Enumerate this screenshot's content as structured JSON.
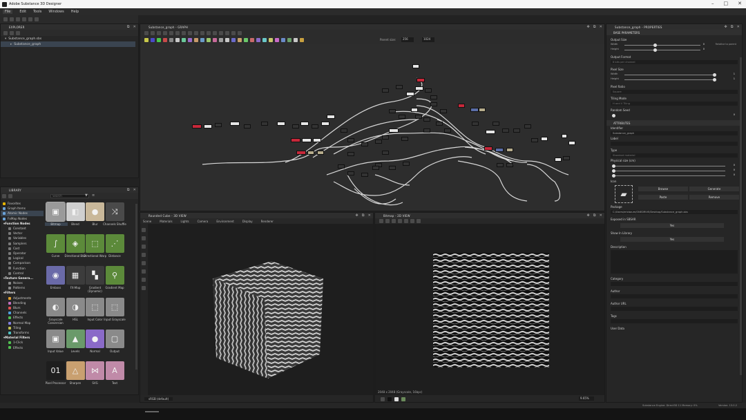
{
  "window": {
    "title": "Adobe Substance 3D Designer"
  },
  "menu": [
    "File",
    "Edit",
    "Tools",
    "Windows",
    "Help"
  ],
  "explorer": {
    "header": "EXPLORER",
    "file": "Substance_graph.sbs",
    "graph": "Substance_graph"
  },
  "graph": {
    "header": "Substance_graph - GRAPH",
    "parent_size_label": "Parent size:",
    "parent_size_value": "256",
    "size_value": "1024"
  },
  "library": {
    "header": "LIBRARY",
    "search_placeholder": "Search",
    "categories": [
      {
        "name": "Favorites",
        "type": "cat-item",
        "color": "#e6b400"
      },
      {
        "name": "Graph Items",
        "type": "cat-item",
        "color": "#6aa2d8"
      },
      {
        "name": "Atomic Nodes",
        "type": "cat-item-sel",
        "color": "#6aa2d8"
      },
      {
        "name": "FxMap Nodes",
        "type": "cat-item",
        "color": "#6aa2d8"
      },
      {
        "name": "Function Nodes",
        "type": "cat",
        "color": "#9a9a9a"
      },
      {
        "name": "Constant",
        "type": "sub",
        "color": "#7a7a7a"
      },
      {
        "name": "Vector",
        "type": "sub",
        "color": "#7a7a7a"
      },
      {
        "name": "Variables",
        "type": "sub",
        "color": "#7a7a7a"
      },
      {
        "name": "Samplers",
        "type": "sub",
        "color": "#7a7a7a"
      },
      {
        "name": "Cast",
        "type": "sub",
        "color": "#7a7a7a"
      },
      {
        "name": "Operator",
        "type": "sub",
        "color": "#7a7a7a"
      },
      {
        "name": "Logical",
        "type": "sub",
        "color": "#7a7a7a"
      },
      {
        "name": "Comparison",
        "type": "sub",
        "color": "#7a7a7a"
      },
      {
        "name": "Function",
        "type": "sub",
        "color": "#7a7a7a"
      },
      {
        "name": "Control",
        "type": "sub",
        "color": "#7a7a7a"
      },
      {
        "name": "Texture Genera...",
        "type": "cat",
        "color": "#9a9a9a"
      },
      {
        "name": "Noises",
        "type": "sub",
        "color": "#8a8a8a"
      },
      {
        "name": "Patterns",
        "type": "sub",
        "color": "#8a8a8a"
      },
      {
        "name": "Filters",
        "type": "cat",
        "color": "#9a9a9a"
      },
      {
        "name": "Adjustments",
        "type": "sub",
        "color": "#e0a030"
      },
      {
        "name": "Blending",
        "type": "sub",
        "color": "#c070c0"
      },
      {
        "name": "Blurs",
        "type": "sub",
        "color": "#e05050"
      },
      {
        "name": "Channels",
        "type": "sub",
        "color": "#50a0e0"
      },
      {
        "name": "Effects",
        "type": "sub",
        "color": "#50c050"
      },
      {
        "name": "Normal Map",
        "type": "sub",
        "color": "#8080e0"
      },
      {
        "name": "Tiling",
        "type": "sub",
        "color": "#c0c050"
      },
      {
        "name": "Transforms",
        "type": "sub",
        "color": "#50c0c0"
      },
      {
        "name": "Material Filters",
        "type": "cat",
        "color": "#9a9a9a"
      },
      {
        "name": "1-Click",
        "type": "sub",
        "color": "#50c050"
      },
      {
        "name": "Effects",
        "type": "sub",
        "color": "#50c050"
      }
    ],
    "tiles": [
      {
        "label": "Bitmap",
        "color": "#9a9a9a",
        "glyph": "▣"
      },
      {
        "label": "Blend",
        "color": "#cfcfcf",
        "glyph": "◧"
      },
      {
        "label": "Blur",
        "color": "#c9b89a",
        "glyph": "●"
      },
      {
        "label": "Channels Shuffle",
        "color": "#4a4a4a",
        "glyph": "⤨"
      },
      {
        "label": "Curve",
        "color": "#5c8a3a",
        "glyph": "∫"
      },
      {
        "label": "Directional Blur",
        "color": "#5c8a3a",
        "glyph": "◈"
      },
      {
        "label": "Directional Warp",
        "color": "#5c8a3a",
        "glyph": "⬚"
      },
      {
        "label": "Distance",
        "color": "#5c8a3a",
        "glyph": "⋰"
      },
      {
        "label": "Emboss",
        "color": "#6a6aa8",
        "glyph": "◉"
      },
      {
        "label": "FX-Map",
        "color": "#3c3c3c",
        "glyph": "▦"
      },
      {
        "label": "Gradient (Dynamic)",
        "color": "#3c3c3c",
        "glyph": "▚"
      },
      {
        "label": "Gradient Map",
        "color": "#5c8a3a",
        "glyph": "⚲"
      },
      {
        "label": "Grayscale Conversion",
        "color": "#8a8a8a",
        "glyph": "◐"
      },
      {
        "label": "HSL",
        "color": "#8a8a8a",
        "glyph": "◑"
      },
      {
        "label": "Input Color",
        "color": "#8a8a8a",
        "glyph": "⬚"
      },
      {
        "label": "Input Grayscale",
        "color": "#8a8a8a",
        "glyph": "⬚"
      },
      {
        "label": "Input Value",
        "color": "#8a8a8a",
        "glyph": "▣"
      },
      {
        "label": "Levels",
        "color": "#6a9a6a",
        "glyph": "▲"
      },
      {
        "label": "Normal",
        "color": "#8a6ac8",
        "glyph": "●"
      },
      {
        "label": "Output",
        "color": "#8a8a8a",
        "glyph": "▢"
      },
      {
        "label": "Pixel Processor",
        "color": "#1e1e1e",
        "glyph": "01"
      },
      {
        "label": "Sharpen",
        "color": "#c9a070",
        "glyph": "△"
      },
      {
        "label": "SVG",
        "color": "#c08aa8",
        "glyph": "⋈"
      },
      {
        "label": "Text",
        "color": "#c08aa8",
        "glyph": "A"
      }
    ]
  },
  "view3d": {
    "header": "Rounded Cube - 3D VIEW",
    "tabs": [
      "Scene",
      "Materials",
      "Lights",
      "Camera",
      "Environment",
      "Display",
      "Renderer"
    ],
    "status": "sRGB (default)"
  },
  "view2d": {
    "header": "Bitmap - 2D VIEW",
    "status": "2048 x 2048 (Grayscale, 16bpc)",
    "zoom": "9.65%"
  },
  "properties": {
    "header": "Substance_graph - PROPERTIES",
    "sections": {
      "base": "BASE PARAMETERS",
      "attributes": "ATTRIBUTES"
    },
    "output_size": {
      "label": "Output Size",
      "width_label": "Width",
      "height_label": "Height",
      "width_val": "0",
      "height_val": "0",
      "rel": "Relative to parent"
    },
    "output_format": {
      "label": "Output Format",
      "value": "8 bits per channel"
    },
    "pixel_size": {
      "label": "Pixel Size",
      "width_label": "Width",
      "height_label": "Height",
      "width_val": "1",
      "height_val": "1"
    },
    "pixel_ratio": {
      "label": "Pixel Ratio",
      "value": "Square"
    },
    "tiling_mode": {
      "label": "Tiling Mode",
      "value": "H and V Tiling"
    },
    "random_seed": {
      "label": "Random Seed",
      "value": "0"
    },
    "identifier": {
      "label": "Identifier",
      "value": "Substance_graph"
    },
    "label": {
      "label": "Label"
    },
    "type": {
      "label": "Type",
      "value": "Standard material"
    },
    "physical": {
      "label": "Physical size (cm)",
      "x": "0",
      "y": "0",
      "z": "0"
    },
    "icon": {
      "label": "Icon",
      "browse": "Browse",
      "generate": "Generate",
      "paste": "Paste",
      "remove": "Remove"
    },
    "package": {
      "label": "Package",
      "value": "C:/Users/ericbaum/ONEDRIVE/Desktop/Substance_graph.sbs"
    },
    "exposed": {
      "label": "Exposed in SBSAR",
      "value": "Yes"
    },
    "show_library": {
      "label": "Show In Library",
      "value": "Yes"
    },
    "description": {
      "label": "Description"
    },
    "category": {
      "label": "Category"
    },
    "author": {
      "label": "Author"
    },
    "author_url": {
      "label": "Author URL"
    },
    "tags": {
      "label": "Tags"
    },
    "user_data": {
      "label": "User Data"
    }
  },
  "statusbar": {
    "engine": "Substance Engine: Direct3D 11  Memory: 0%",
    "version": "Version: 13.0.2"
  }
}
